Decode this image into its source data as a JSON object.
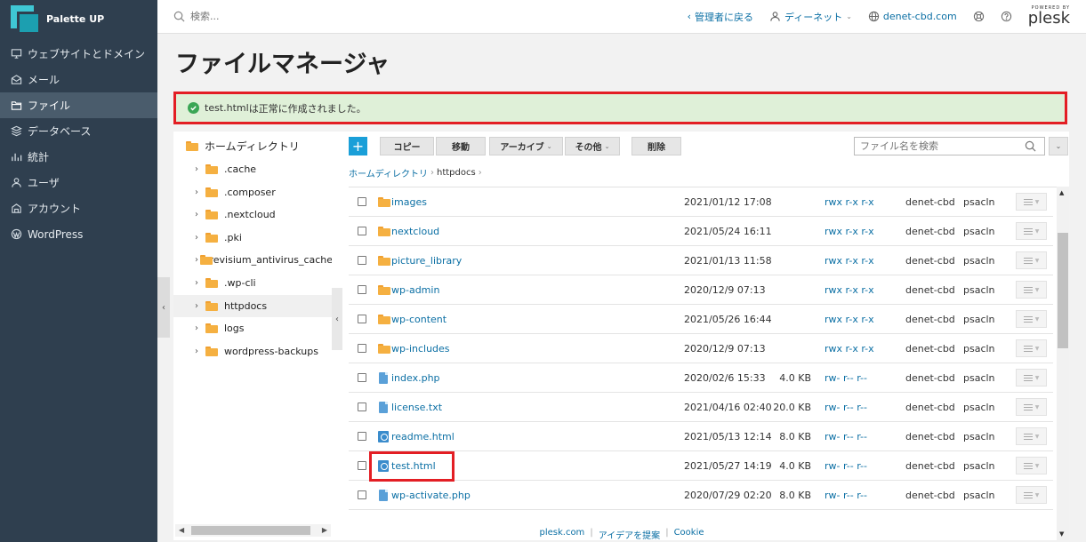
{
  "brand": {
    "name": "Palette UP"
  },
  "sidebar": {
    "items": [
      {
        "label": "ウェブサイトとドメイン",
        "icon": "monitor-icon"
      },
      {
        "label": "メール",
        "icon": "mail-icon"
      },
      {
        "label": "ファイル",
        "icon": "folder-icon",
        "active": true
      },
      {
        "label": "データベース",
        "icon": "database-icon"
      },
      {
        "label": "統計",
        "icon": "stats-icon"
      },
      {
        "label": "ユーザ",
        "icon": "user-icon"
      },
      {
        "label": "アカウント",
        "icon": "account-icon"
      },
      {
        "label": "WordPress",
        "icon": "wordpress-icon"
      }
    ]
  },
  "topbar": {
    "search_placeholder": "検索...",
    "back_admin": "管理者に戻る",
    "user": "ディーネット",
    "domain": "denet-cbd.com",
    "powered_by": "POWERED BY",
    "plesk": "plesk"
  },
  "page": {
    "title": "ファイルマネージャ"
  },
  "alert": {
    "filename": "test.html",
    "message": " は正常に作成されました。"
  },
  "tree": {
    "root": "ホームディレクトリ",
    "items": [
      {
        "label": ".cache"
      },
      {
        "label": ".composer"
      },
      {
        "label": ".nextcloud"
      },
      {
        "label": ".pki"
      },
      {
        "label": ".revisium_antivirus_cache"
      },
      {
        "label": ".wp-cli"
      },
      {
        "label": "httpdocs",
        "selected": true
      },
      {
        "label": "logs"
      },
      {
        "label": "wordpress-backups"
      }
    ]
  },
  "toolbar": {
    "add_label": "+",
    "copy": "コピー",
    "move": "移動",
    "archive": "アーカイブ",
    "other": "その他",
    "delete": "削除",
    "search_placeholder": "ファイル名を検索"
  },
  "breadcrumb": {
    "home": "ホームディレクトリ",
    "current": "httpdocs"
  },
  "files": [
    {
      "name": "images",
      "type": "folder",
      "date": "2021/01/12 17:08",
      "size": "",
      "perm": "rwx r-x r-x",
      "owner": "denet-cbd",
      "group": "psacln"
    },
    {
      "name": "nextcloud",
      "type": "folder",
      "date": "2021/05/24 16:11",
      "size": "",
      "perm": "rwx r-x r-x",
      "owner": "denet-cbd",
      "group": "psacln"
    },
    {
      "name": "picture_library",
      "type": "folder",
      "date": "2021/01/13 11:58",
      "size": "",
      "perm": "rwx r-x r-x",
      "owner": "denet-cbd",
      "group": "psacln"
    },
    {
      "name": "wp-admin",
      "type": "folder",
      "date": "2020/12/9 07:13",
      "size": "",
      "perm": "rwx r-x r-x",
      "owner": "denet-cbd",
      "group": "psacln"
    },
    {
      "name": "wp-content",
      "type": "folder",
      "date": "2021/05/26 16:44",
      "size": "",
      "perm": "rwx r-x r-x",
      "owner": "denet-cbd",
      "group": "psacln"
    },
    {
      "name": "wp-includes",
      "type": "folder",
      "date": "2020/12/9 07:13",
      "size": "",
      "perm": "rwx r-x r-x",
      "owner": "denet-cbd",
      "group": "psacln"
    },
    {
      "name": "index.php",
      "type": "doc",
      "date": "2020/02/6 15:33",
      "size": "4.0 KB",
      "perm": "rw- r-- r--",
      "owner": "denet-cbd",
      "group": "psacln"
    },
    {
      "name": "license.txt",
      "type": "doc",
      "date": "2021/04/16 02:40",
      "size": "20.0 KB",
      "perm": "rw- r-- r--",
      "owner": "denet-cbd",
      "group": "psacln"
    },
    {
      "name": "readme.html",
      "type": "html",
      "date": "2021/05/13 12:14",
      "size": "8.0 KB",
      "perm": "rw- r-- r--",
      "owner": "denet-cbd",
      "group": "psacln"
    },
    {
      "name": "test.html",
      "type": "html",
      "date": "2021/05/27 14:19",
      "size": "4.0 KB",
      "perm": "rw- r-- r--",
      "owner": "denet-cbd",
      "group": "psacln"
    },
    {
      "name": "wp-activate.php",
      "type": "doc",
      "date": "2020/07/29 02:20",
      "size": "8.0 KB",
      "perm": "rw- r-- r--",
      "owner": "denet-cbd",
      "group": "psacln"
    }
  ],
  "footer": {
    "links": [
      "plesk.com",
      "アイデアを提案",
      "Cookie"
    ]
  },
  "colors": {
    "sidebar_bg": "#2f3f4f",
    "accent": "#1a9fd8",
    "link": "#0b6fa4",
    "alert_bg": "#dff0d8",
    "highlight": "#e31e24",
    "folder": "#f5b041"
  }
}
